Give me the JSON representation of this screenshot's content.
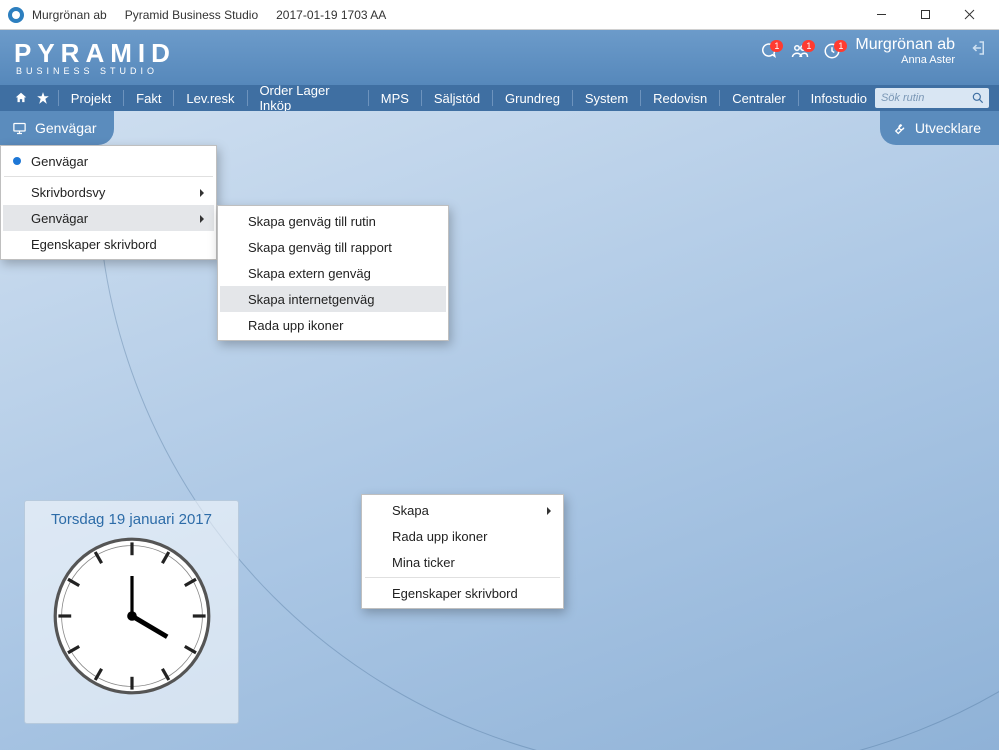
{
  "titlebar": {
    "company": "Murgrönan ab",
    "app": "Pyramid Business Studio",
    "datetime": "2017-01-19  1703  AA"
  },
  "brand": {
    "logo_main": "PYRAMID",
    "logo_sub": "BUSINESS STUDIO",
    "company": "Murgrönan ab",
    "user": "Anna Aster",
    "badge1": "1",
    "badge2": "1",
    "badge3": "1"
  },
  "menubar": {
    "items": [
      "Projekt",
      "Fakt",
      "Lev.resk",
      "Order Lager Inköp",
      "MPS",
      "Säljstöd",
      "Grundreg",
      "System",
      "Redovisn",
      "Centraler",
      "Infostudio"
    ],
    "search_placeholder": "Sök rutin"
  },
  "tabs": {
    "left": "Genvägar",
    "right": "Utvecklare"
  },
  "menu1": {
    "item0": "Genvägar",
    "item1": "Skrivbordsvy",
    "item2": "Genvägar",
    "item3": "Egenskaper skrivbord"
  },
  "submenu1": {
    "item0": "Skapa genväg till rutin",
    "item1": "Skapa genväg till rapport",
    "item2": "Skapa extern genväg",
    "item3": "Skapa internetgenväg",
    "item4": "Rada upp ikoner"
  },
  "context": {
    "item0": "Skapa",
    "item1": "Rada upp ikoner",
    "item2": "Mina ticker",
    "item3": "Egenskaper skrivbord"
  },
  "widget": {
    "date": "Torsdag 19 januari 2017"
  }
}
